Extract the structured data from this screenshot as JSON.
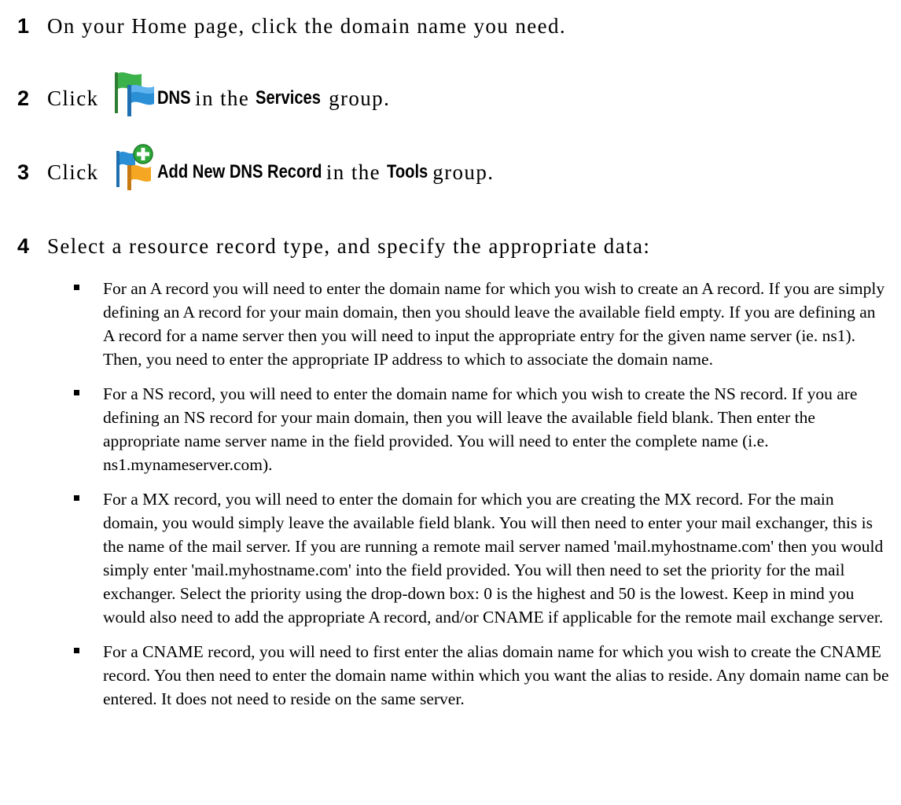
{
  "steps": [
    {
      "number": "1",
      "text": "On your Home page, click the domain name you need."
    },
    {
      "number": "2",
      "prefix": "Click",
      "icon": "dns-flags-icon",
      "term": "DNS",
      "middle": "in the",
      "group": "Services",
      "suffix": "group."
    },
    {
      "number": "3",
      "prefix": "Click",
      "icon": "add-dns-record-icon",
      "term": "Add New DNS Record",
      "middle": "in the",
      "group": "Tools",
      "suffix": "group."
    },
    {
      "number": "4",
      "text": "Select a resource record type, and specify the appropriate data:"
    }
  ],
  "bullets": [
    "For an A record you will need to enter the domain name for which you wish to create an A record. If you are simply defining an A record for your main domain, then you should leave the available field empty. If you are defining an A record for a name server then you will need to input the appropriate entry for the given name server (ie. ns1). Then, you need to enter the appropriate IP address to which to associate the domain name.",
    "For a NS record, you will need to enter the domain name for which you wish to create the NS record. If you are defining an NS record for your main domain, then you will leave the available field blank. Then enter the appropriate name server name in the field provided. You will need to enter the complete name (i.e. ns1.mynameserver.com).",
    "For a MX record, you will need to enter the domain for which you are creating the MX record. For the main domain, you would simply leave the available field blank. You will then need to enter your mail exchanger, this is the name of the mail server. If you are running a remote mail server named 'mail.myhostname.com' then you would simply enter 'mail.myhostname.com' into the field provided. You will then need to set the priority for the mail exchanger. Select the priority using the drop-down box: 0 is the highest and 50 is the lowest. Keep in mind you would also need to add the appropriate A record, and/or CNAME if applicable for the remote mail exchange server.",
    "For a CNAME record, you will need to first enter the alias domain name for which you wish to create the CNAME record. You then need to enter the domain name within which you want the alias to reside. Any domain name can be entered. It does not need to reside on the same server."
  ],
  "colors": {
    "flag_green": "#3cb24a",
    "flag_blue": "#2b8fd6",
    "flag_orange": "#f5a623",
    "plus_green": "#2fa83a"
  }
}
